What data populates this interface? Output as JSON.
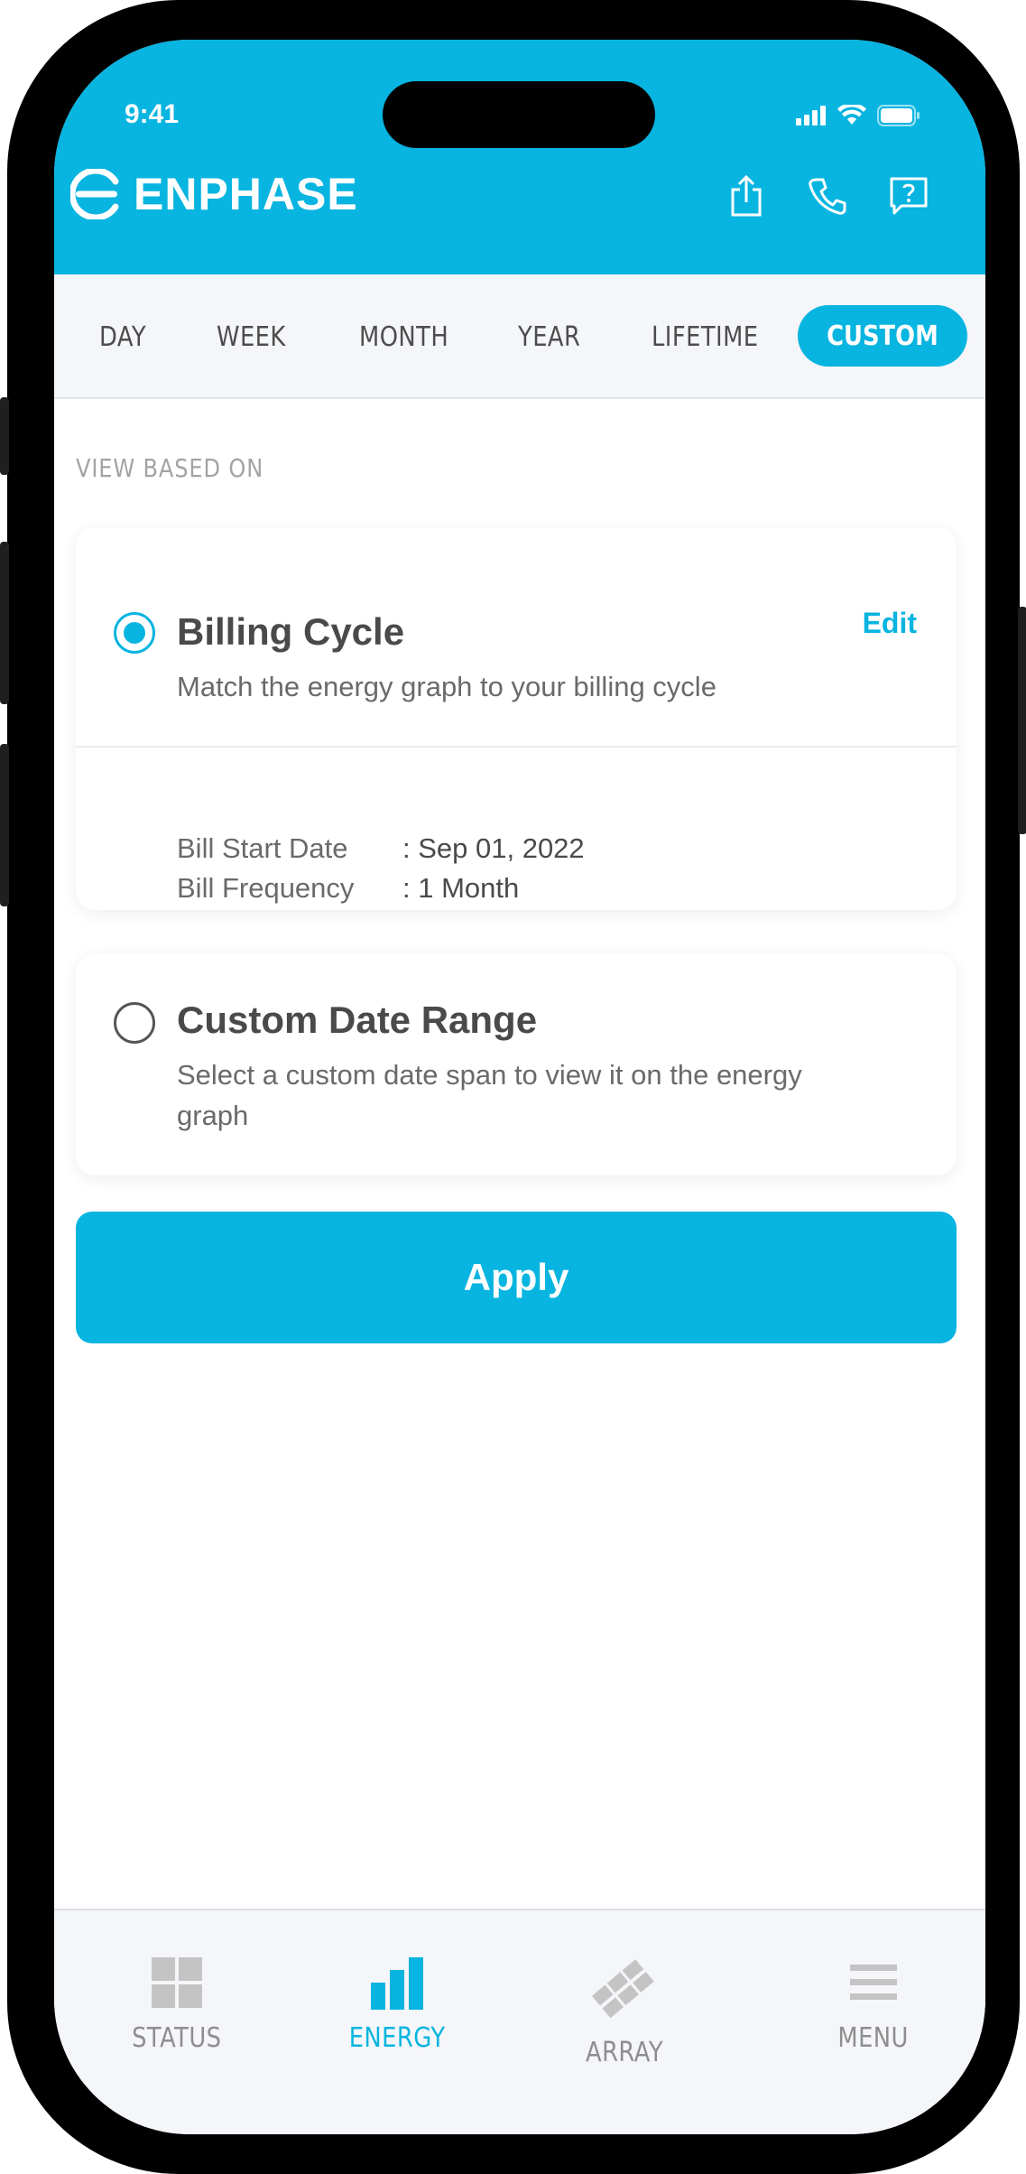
{
  "status_bar": {
    "time": "9:41"
  },
  "brand": {
    "name": "ENPHASE",
    "accent_color": "#08b4e0"
  },
  "header_actions": {
    "share_icon": "share-icon",
    "phone_icon": "phone-icon",
    "help_icon": "help-icon"
  },
  "tabs": [
    {
      "label": "DAY"
    },
    {
      "label": "WEEK"
    },
    {
      "label": "MONTH"
    },
    {
      "label": "YEAR"
    },
    {
      "label": "LIFETIME"
    },
    {
      "label": "CUSTOM",
      "active": true
    }
  ],
  "section_label": "VIEW BASED ON",
  "options": {
    "billing": {
      "title": "Billing Cycle",
      "description": "Match the energy graph to your billing cycle",
      "selected": true,
      "edit_label": "Edit",
      "start_date_label": "Bill Start Date",
      "start_date_value": ": Sep 01, 2022",
      "frequency_label": "Bill Frequency",
      "frequency_value": ": 1 Month"
    },
    "custom": {
      "title": "Custom Date Range",
      "description": "Select a custom date span to view it on the energy graph",
      "selected": false
    }
  },
  "apply_label": "Apply",
  "bottom_nav": [
    {
      "label": "STATUS",
      "icon": "grid-icon"
    },
    {
      "label": "ENERGY",
      "icon": "bar-chart-icon",
      "active": true
    },
    {
      "label": "ARRAY",
      "icon": "panels-icon"
    },
    {
      "label": "MENU",
      "icon": "menu-icon"
    }
  ]
}
